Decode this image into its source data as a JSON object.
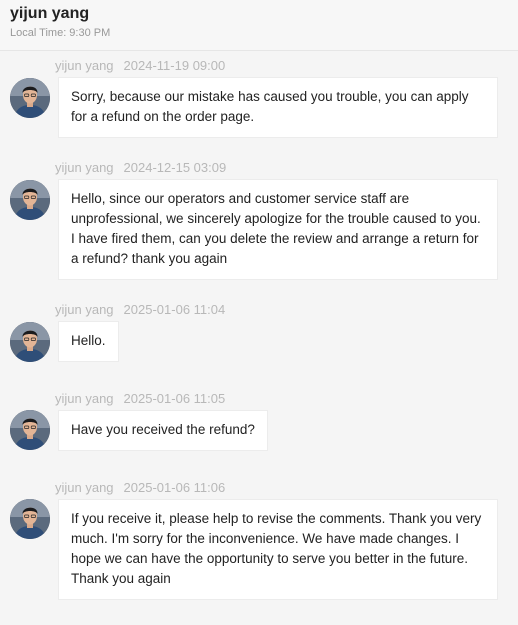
{
  "header": {
    "contact_name": "yijun yang",
    "local_time": "Local Time: 9:30 PM"
  },
  "messages": [
    {
      "sender": "yijun yang",
      "timestamp": "2024-11-19 09:00",
      "text": "Sorry, because our mistake has caused you trouble, you can apply for a refund on the order page."
    },
    {
      "sender": "yijun yang",
      "timestamp": "2024-12-15 03:09",
      "text": "Hello, since our operators and customer service staff are unprofessional, we sincerely apologize for the trouble caused to you. I have fired them, can you delete the review and arrange a return for a refund? thank you again"
    },
    {
      "sender": "yijun yang",
      "timestamp": "2025-01-06 11:04",
      "text": "Hello."
    },
    {
      "sender": "yijun yang",
      "timestamp": "2025-01-06 11:05",
      "text": "Have you received the refund?"
    },
    {
      "sender": "yijun yang",
      "timestamp": "2025-01-06 11:06",
      "text": "If you receive it, please help to revise the comments. Thank you very much. I'm sorry for the inconvenience. We have made changes. I hope we can have the opportunity to serve you better in the future. Thank you again"
    }
  ]
}
